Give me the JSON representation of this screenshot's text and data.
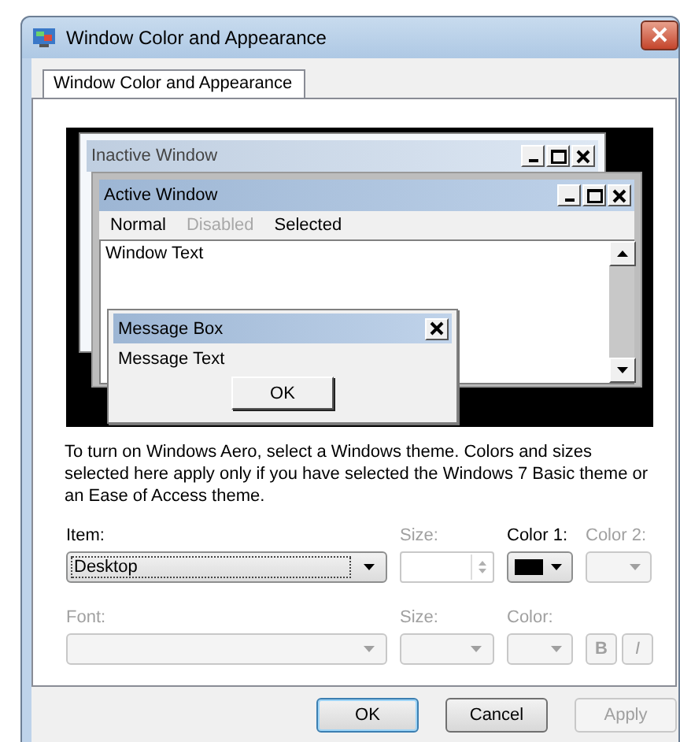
{
  "window": {
    "title": "Window Color and Appearance"
  },
  "tabs": [
    {
      "label": "Window Color and Appearance",
      "selected": true
    }
  ],
  "preview": {
    "inactive_window": {
      "title": "Inactive Window"
    },
    "active_window": {
      "title": "Active Window",
      "menu": [
        {
          "label": "Normal",
          "disabled": false
        },
        {
          "label": "Disabled",
          "disabled": true
        },
        {
          "label": "Selected",
          "disabled": false
        }
      ],
      "text": "Window Text"
    },
    "message_box": {
      "title": "Message Box",
      "text": "Message Text",
      "button": "OK"
    }
  },
  "description": "To turn on Windows Aero, select a Windows theme.  Colors and sizes selected here apply only if you have selected the Windows 7 Basic theme or an Ease of Access theme.",
  "rows": [
    [
      {
        "kind": "dropdown",
        "label": "Item:",
        "value": "Desktop",
        "disabled": false
      },
      {
        "kind": "spinner",
        "label": "Size:",
        "disabled": true
      },
      {
        "kind": "color",
        "label": "Color 1:",
        "color": "#000000",
        "disabled": false
      },
      {
        "kind": "color",
        "label": "Color 2:",
        "disabled": true
      }
    ],
    [
      {
        "kind": "dropdown",
        "label": "Font:",
        "disabled": true
      },
      {
        "kind": "dropdown",
        "label": "Size:",
        "disabled": true
      },
      {
        "kind": "color",
        "label": "Color:",
        "disabled": true
      },
      {
        "kind": "styles",
        "buttons": [
          "B",
          "I"
        ],
        "disabled": true
      }
    ]
  ],
  "buttons": [
    {
      "label": "OK",
      "default": true,
      "disabled": false
    },
    {
      "label": "Cancel",
      "default": false,
      "disabled": false
    },
    {
      "label": "Apply",
      "default": false,
      "disabled": true
    }
  ]
}
